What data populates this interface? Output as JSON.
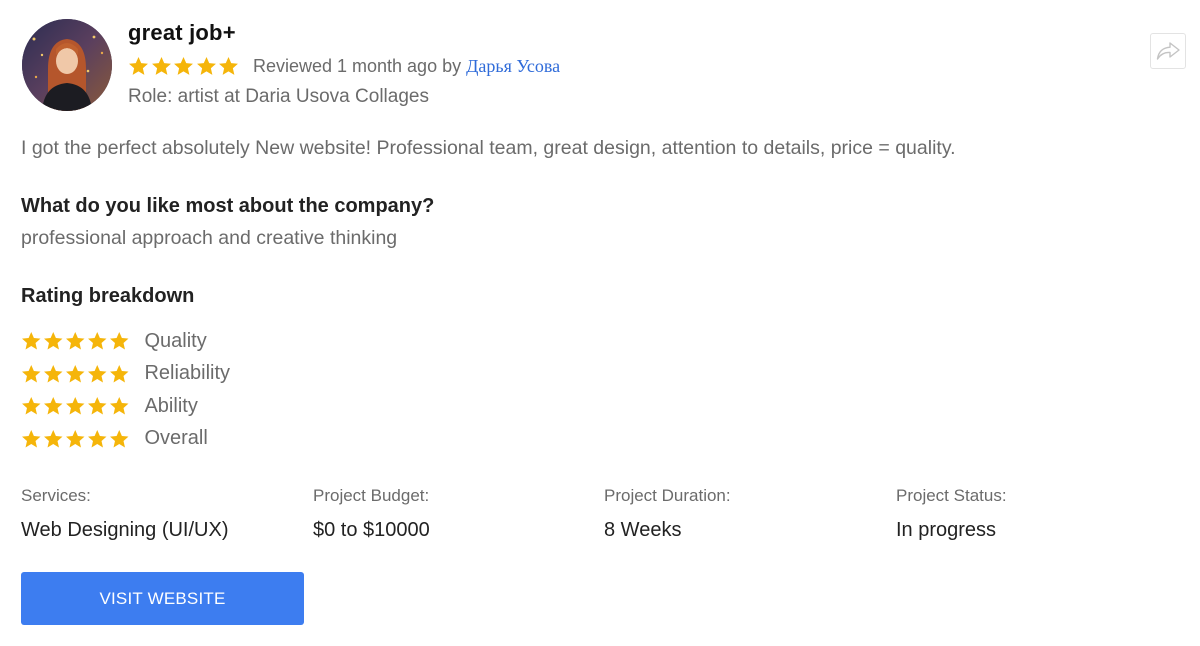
{
  "review": {
    "title": "great job+",
    "rating": 5,
    "reviewed_text": "Reviewed 1 month ago by",
    "reviewer_name": "Дарья Усова",
    "role": "Role: artist at Daria Usova Collages",
    "body": "I got the perfect absolutely New website! Professional team, great design, attention to details, price = quality.",
    "question": "What do you like most about the company?",
    "answer": "professional approach and creative thinking"
  },
  "share": {
    "icon": "share-arrow-icon"
  },
  "rating_breakdown": {
    "heading": "Rating breakdown",
    "items": [
      {
        "label": "Quality",
        "stars": 5
      },
      {
        "label": "Reliability",
        "stars": 5
      },
      {
        "label": "Ability",
        "stars": 5
      },
      {
        "label": "Overall",
        "stars": 5
      }
    ]
  },
  "details": {
    "services": {
      "label": "Services:",
      "value": "Web Designing (UI/UX)"
    },
    "budget": {
      "label": "Project Budget:",
      "value": "$0 to $10000"
    },
    "duration": {
      "label": "Project Duration:",
      "value": "8 Weeks"
    },
    "status": {
      "label": "Project Status:",
      "value": "In progress"
    }
  },
  "actions": {
    "visit_label": "VISIT WEBSITE"
  },
  "colors": {
    "star": "#f5b50a",
    "link": "#2f6bd9",
    "button": "#3d7df0",
    "muted_text": "#6b6b6b"
  }
}
